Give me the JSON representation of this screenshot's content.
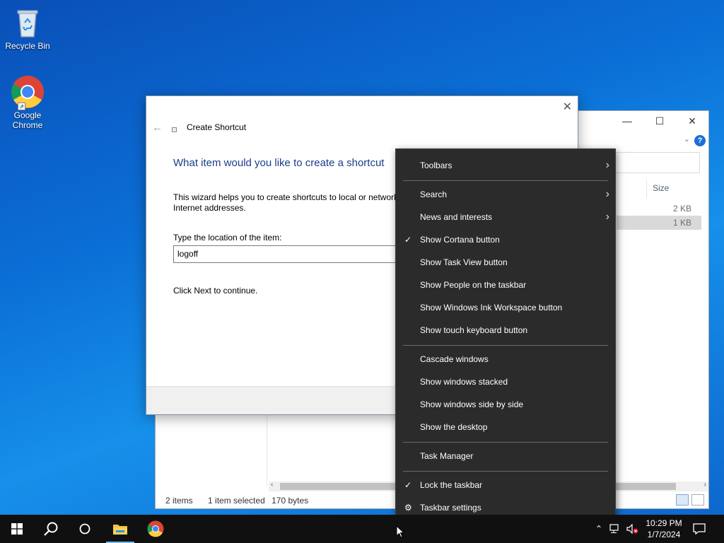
{
  "desktop": {
    "icons": [
      {
        "label": "Recycle Bin"
      },
      {
        "label": "Google Chrome"
      }
    ]
  },
  "explorer": {
    "column_size": "Size",
    "rows": [
      "2 KB",
      "1 KB"
    ],
    "status": {
      "items": "2 items",
      "selected": "1 item selected",
      "size": "170 bytes"
    }
  },
  "wizard": {
    "title": "Create Shortcut",
    "heading": "What item would you like to create a shortcut",
    "description": "This wizard helps you to create shortcuts to local or network Internet addresses.",
    "location_label": "Type the location of the item:",
    "location_value": "logoff",
    "continue_text": "Click Next to continue."
  },
  "context_menu": {
    "toolbars": "Toolbars",
    "search": "Search",
    "news": "News and interests",
    "cortana": "Show Cortana button",
    "task_view": "Show Task View button",
    "people": "Show People on the taskbar",
    "ink": "Show Windows Ink Workspace button",
    "touch_keyboard": "Show touch keyboard button",
    "cascade": "Cascade windows",
    "stacked": "Show windows stacked",
    "side_by_side": "Show windows side by side",
    "desktop": "Show the desktop",
    "task_manager": "Task Manager",
    "lock": "Lock the taskbar",
    "settings": "Taskbar settings"
  },
  "taskbar": {
    "time": "10:29 PM",
    "date": "1/7/2024"
  },
  "colors": {
    "menu_bg": "#2b2b2b",
    "heading_blue": "#1a3d8a",
    "taskbar_bg": "#101010",
    "accent": "#76b9ed"
  }
}
